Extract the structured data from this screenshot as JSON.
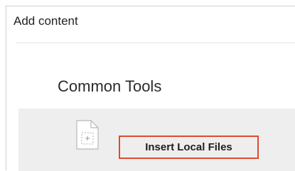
{
  "dialog": {
    "title": "Add content"
  },
  "section": {
    "title": "Common Tools"
  },
  "tools": [
    {
      "label": "Insert Local Files",
      "icon": "file-add-icon"
    }
  ],
  "colors": {
    "highlight_border": "#e04a2f",
    "row_background": "#eeeeee"
  }
}
